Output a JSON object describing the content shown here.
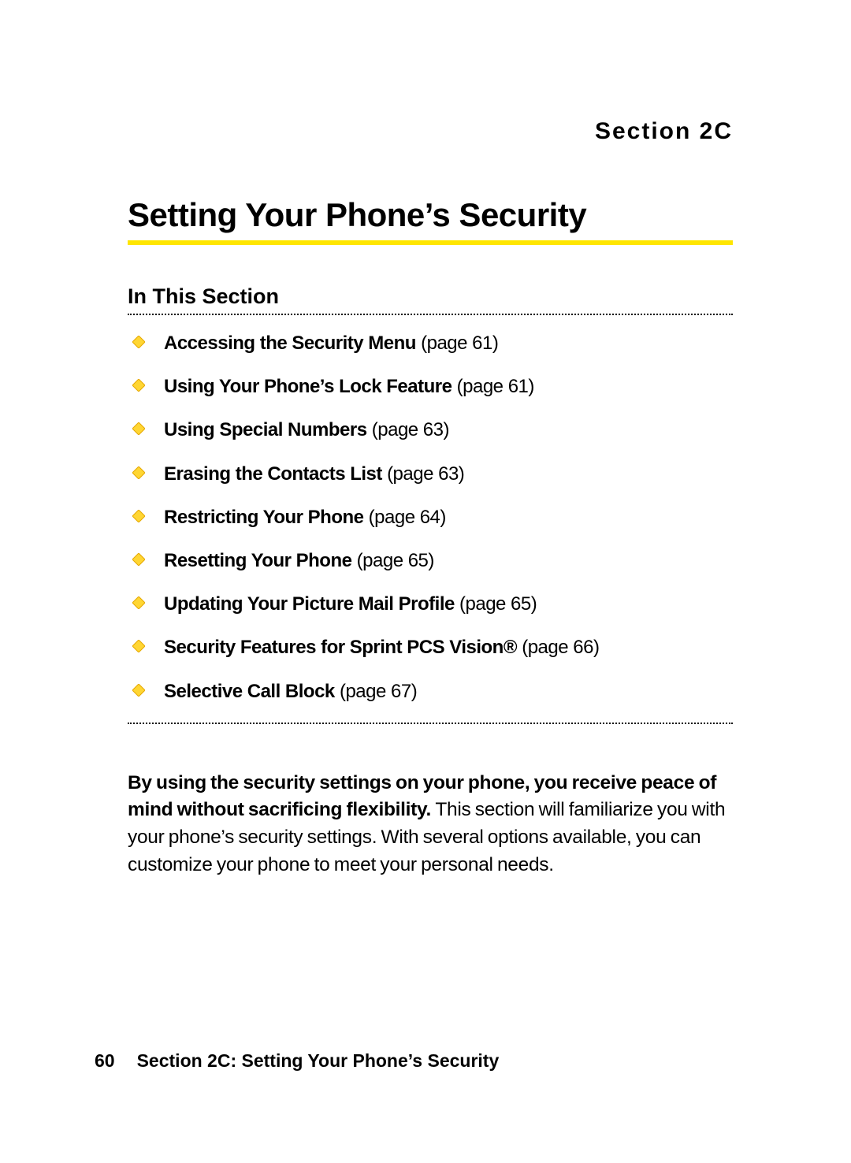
{
  "section_label": "Section 2C",
  "title": "Setting Your Phone’s Security",
  "in_this_section_label": "In This Section",
  "toc": [
    {
      "title": "Accessing the Security Menu",
      "page": "(page 61)"
    },
    {
      "title": "Using Your Phone’s Lock Feature",
      "page": "(page 61)"
    },
    {
      "title": "Using Special Numbers",
      "page": "(page 63)"
    },
    {
      "title": "Erasing the Contacts List",
      "page": "(page 63)"
    },
    {
      "title": "Restricting Your Phone",
      "page": "(page 64)"
    },
    {
      "title": "Resetting Your Phone",
      "page": "(page 65)"
    },
    {
      "title": "Updating Your Picture Mail Profile",
      "page": "(page 65)"
    },
    {
      "title": "Security Features for Sprint PCS Vision®",
      "page": "(page 66)"
    },
    {
      "title": "Selective Call Block",
      "page": "(page 67)"
    }
  ],
  "body": {
    "bold": "By using the security settings on your phone, you receive peace of mind without sacrificing flexibility. ",
    "rest": "This section will familiarize you with your phone’s security settings. With several options available, you can customize your phone to meet your personal needs."
  },
  "footer": {
    "page_number": "60",
    "text": "Section 2C: Setting Your Phone’s Security"
  },
  "colors": {
    "accent_yellow": "#ffe600",
    "diamond_fill": "#ffd633",
    "diamond_stroke": "#e6a800"
  }
}
